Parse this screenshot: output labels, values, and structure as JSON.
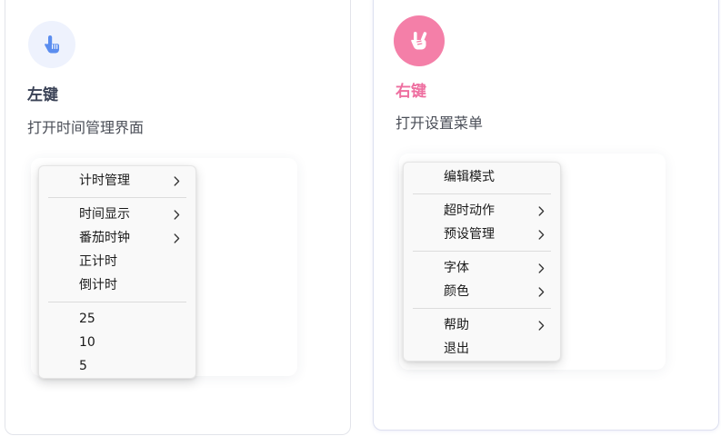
{
  "left_card": {
    "title": "左键",
    "description": "打开时间管理界面",
    "icon": "pointer-hand-icon",
    "accent": "#5b8def",
    "menu": {
      "groups": [
        [
          {
            "label": "计时管理",
            "submenu": true
          }
        ],
        [
          {
            "label": "时间显示",
            "submenu": true
          },
          {
            "label": "番茄时钟",
            "submenu": true
          },
          {
            "label": "正计时",
            "submenu": false
          },
          {
            "label": "倒计时",
            "submenu": false
          }
        ],
        [
          {
            "label": "25",
            "submenu": false
          },
          {
            "label": "10",
            "submenu": false
          },
          {
            "label": "5",
            "submenu": false
          }
        ]
      ]
    }
  },
  "right_card": {
    "title": "右键",
    "description": "打开设置菜单",
    "icon": "rock-hand-icon",
    "accent": "#ee6fa0",
    "menu": {
      "groups": [
        [
          {
            "label": "编辑模式",
            "submenu": false
          }
        ],
        [
          {
            "label": "超时动作",
            "submenu": true
          },
          {
            "label": "预设管理",
            "submenu": true
          }
        ],
        [
          {
            "label": "字体",
            "submenu": true
          },
          {
            "label": "颜色",
            "submenu": true
          }
        ],
        [
          {
            "label": "帮助",
            "submenu": true
          },
          {
            "label": "退出",
            "submenu": false
          }
        ]
      ]
    }
  }
}
